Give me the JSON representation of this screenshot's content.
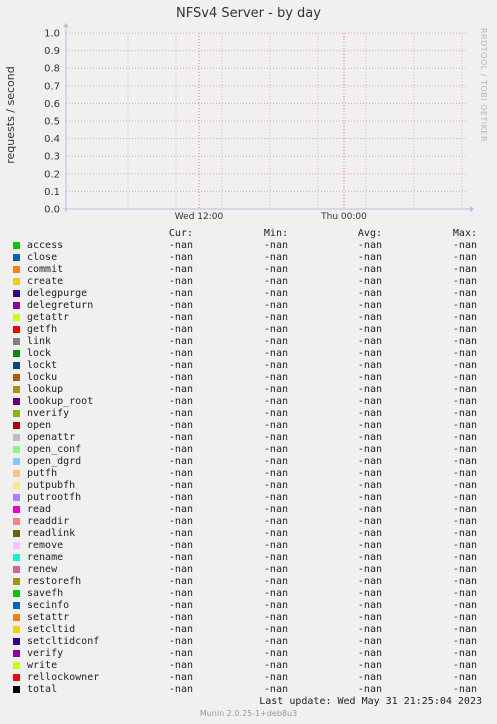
{
  "chart_data": {
    "type": "line",
    "title": "NFSv4 Server - by day",
    "ylabel": "requests / second",
    "yticks": [
      "0.0",
      "0.1",
      "0.2",
      "0.3",
      "0.4",
      "0.5",
      "0.6",
      "0.7",
      "0.8",
      "0.9",
      "1.0"
    ],
    "ylim": [
      0,
      1
    ],
    "xticks": [
      "Wed 12:00",
      "Thu 00:00"
    ],
    "grid": true,
    "series": []
  },
  "watermark": "RRDTOOL / TOBI OETIKER",
  "legend": {
    "headers": {
      "cur": "Cur:",
      "min": "Min:",
      "avg": "Avg:",
      "max": "Max:"
    },
    "rows": [
      {
        "name": "access",
        "color": "#00cc00",
        "cur": "-nan",
        "min": "-nan",
        "avg": "-nan",
        "max": "-nan"
      },
      {
        "name": "close",
        "color": "#0066b3",
        "cur": "-nan",
        "min": "-nan",
        "avg": "-nan",
        "max": "-nan"
      },
      {
        "name": "commit",
        "color": "#ff8000",
        "cur": "-nan",
        "min": "-nan",
        "avg": "-nan",
        "max": "-nan"
      },
      {
        "name": "create",
        "color": "#ffcc00",
        "cur": "-nan",
        "min": "-nan",
        "avg": "-nan",
        "max": "-nan"
      },
      {
        "name": "delegpurge",
        "color": "#330099",
        "cur": "-nan",
        "min": "-nan",
        "avg": "-nan",
        "max": "-nan"
      },
      {
        "name": "delegreturn",
        "color": "#990099",
        "cur": "-nan",
        "min": "-nan",
        "avg": "-nan",
        "max": "-nan"
      },
      {
        "name": "getattr",
        "color": "#ccff00",
        "cur": "-nan",
        "min": "-nan",
        "avg": "-nan",
        "max": "-nan"
      },
      {
        "name": "getfh",
        "color": "#ff0000",
        "cur": "-nan",
        "min": "-nan",
        "avg": "-nan",
        "max": "-nan"
      },
      {
        "name": "link",
        "color": "#808080",
        "cur": "-nan",
        "min": "-nan",
        "avg": "-nan",
        "max": "-nan"
      },
      {
        "name": "lock",
        "color": "#008f00",
        "cur": "-nan",
        "min": "-nan",
        "avg": "-nan",
        "max": "-nan"
      },
      {
        "name": "lockt",
        "color": "#00487d",
        "cur": "-nan",
        "min": "-nan",
        "avg": "-nan",
        "max": "-nan"
      },
      {
        "name": "locku",
        "color": "#b35a00",
        "cur": "-nan",
        "min": "-nan",
        "avg": "-nan",
        "max": "-nan"
      },
      {
        "name": "lookup",
        "color": "#b38f00",
        "cur": "-nan",
        "min": "-nan",
        "avg": "-nan",
        "max": "-nan"
      },
      {
        "name": "lookup_root",
        "color": "#6b006b",
        "cur": "-nan",
        "min": "-nan",
        "avg": "-nan",
        "max": "-nan"
      },
      {
        "name": "nverify",
        "color": "#8fb300",
        "cur": "-nan",
        "min": "-nan",
        "avg": "-nan",
        "max": "-nan"
      },
      {
        "name": "open",
        "color": "#b30000",
        "cur": "-nan",
        "min": "-nan",
        "avg": "-nan",
        "max": "-nan"
      },
      {
        "name": "openattr",
        "color": "#bebebe",
        "cur": "-nan",
        "min": "-nan",
        "avg": "-nan",
        "max": "-nan"
      },
      {
        "name": "open_conf",
        "color": "#80ff80",
        "cur": "-nan",
        "min": "-nan",
        "avg": "-nan",
        "max": "-nan"
      },
      {
        "name": "open_dgrd",
        "color": "#80c9ff",
        "cur": "-nan",
        "min": "-nan",
        "avg": "-nan",
        "max": "-nan"
      },
      {
        "name": "putfh",
        "color": "#ffc080",
        "cur": "-nan",
        "min": "-nan",
        "avg": "-nan",
        "max": "-nan"
      },
      {
        "name": "putpubfh",
        "color": "#ffe680",
        "cur": "-nan",
        "min": "-nan",
        "avg": "-nan",
        "max": "-nan"
      },
      {
        "name": "putrootfh",
        "color": "#aa80ff",
        "cur": "-nan",
        "min": "-nan",
        "avg": "-nan",
        "max": "-nan"
      },
      {
        "name": "read",
        "color": "#ee00cc",
        "cur": "-nan",
        "min": "-nan",
        "avg": "-nan",
        "max": "-nan"
      },
      {
        "name": "readdir",
        "color": "#ff8080",
        "cur": "-nan",
        "min": "-nan",
        "avg": "-nan",
        "max": "-nan"
      },
      {
        "name": "readlink",
        "color": "#666600",
        "cur": "-nan",
        "min": "-nan",
        "avg": "-nan",
        "max": "-nan"
      },
      {
        "name": "remove",
        "color": "#ffbfff",
        "cur": "-nan",
        "min": "-nan",
        "avg": "-nan",
        "max": "-nan"
      },
      {
        "name": "rename",
        "color": "#00ffcc",
        "cur": "-nan",
        "min": "-nan",
        "avg": "-nan",
        "max": "-nan"
      },
      {
        "name": "renew",
        "color": "#cc6699",
        "cur": "-nan",
        "min": "-nan",
        "avg": "-nan",
        "max": "-nan"
      },
      {
        "name": "restorefh",
        "color": "#999900",
        "cur": "-nan",
        "min": "-nan",
        "avg": "-nan",
        "max": "-nan"
      },
      {
        "name": "savefh",
        "color": "#00cc00",
        "cur": "-nan",
        "min": "-nan",
        "avg": "-nan",
        "max": "-nan"
      },
      {
        "name": "secinfo",
        "color": "#0066b3",
        "cur": "-nan",
        "min": "-nan",
        "avg": "-nan",
        "max": "-nan"
      },
      {
        "name": "setattr",
        "color": "#ff8000",
        "cur": "-nan",
        "min": "-nan",
        "avg": "-nan",
        "max": "-nan"
      },
      {
        "name": "setcltid",
        "color": "#ffcc00",
        "cur": "-nan",
        "min": "-nan",
        "avg": "-nan",
        "max": "-nan"
      },
      {
        "name": "setcltidconf",
        "color": "#330099",
        "cur": "-nan",
        "min": "-nan",
        "avg": "-nan",
        "max": "-nan"
      },
      {
        "name": "verify",
        "color": "#990099",
        "cur": "-nan",
        "min": "-nan",
        "avg": "-nan",
        "max": "-nan"
      },
      {
        "name": "write",
        "color": "#ccff00",
        "cur": "-nan",
        "min": "-nan",
        "avg": "-nan",
        "max": "-nan"
      },
      {
        "name": "rellockowner",
        "color": "#ff0000",
        "cur": "-nan",
        "min": "-nan",
        "avg": "-nan",
        "max": "-nan"
      },
      {
        "name": "total",
        "color": "#000000",
        "cur": "-nan",
        "min": "-nan",
        "avg": "-nan",
        "max": "-nan"
      }
    ]
  },
  "footer": {
    "last_update": "Last update:  Wed May 31 21:25:04 2023",
    "munin": "Munin 2.0.25-1+deb8u3"
  }
}
